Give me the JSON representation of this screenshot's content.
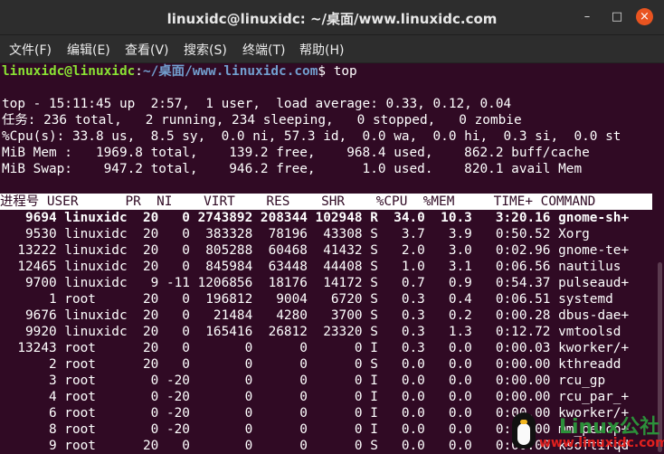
{
  "window": {
    "title": "linuxidc@linuxidc: ~/桌面/www.linuxidc.com",
    "buttons": {
      "minimize": "–",
      "maximize": "□",
      "close": "×"
    },
    "colors": {
      "terminal_bg": "#300a24",
      "prompt_user": "#8ae234",
      "prompt_path": "#729fcf",
      "close_button": "#e95420"
    }
  },
  "menu": [
    {
      "label": "文件(F)"
    },
    {
      "label": "编辑(E)"
    },
    {
      "label": "查看(V)"
    },
    {
      "label": "搜索(S)"
    },
    {
      "label": "终端(T)"
    },
    {
      "label": "帮助(H)"
    }
  ],
  "prompt": {
    "user": "linuxidc@linuxidc",
    "sep": ":",
    "path": "~/桌面/www.linuxidc.com",
    "symbol": "$ ",
    "command": "top"
  },
  "summary": [
    "top - 15:11:45 up  2:57,  1 user,  load average: 0.33, 0.12, 0.04",
    "任务: 236 total,   2 running, 234 sleeping,   0 stopped,   0 zombie",
    "%Cpu(s): 33.8 us,  8.5 sy,  0.0 ni, 57.3 id,  0.0 wa,  0.0 hi,  0.3 si,  0.0 st",
    "MiB Mem :   1969.8 total,    139.2 free,    968.4 used,    862.2 buff/cache",
    "MiB Swap:    947.2 total,    946.2 free,      1.0 used.    820.1 avail Mem"
  ],
  "table": {
    "header": "进程号 USER      PR  NI    VIRT    RES    SHR    %CPU  %MEM     TIME+ COMMAND",
    "rows": [
      "   9694 linuxidc  20   0 2743892 208344 102948 R  34.0  10.3   3:20.16 gnome-sh+",
      "   9530 linuxidc  20   0  383328  78196  43308 S   3.7   3.9   0:50.52 Xorg",
      "  13222 linuxidc  20   0  805288  60468  41432 S   2.0   3.0   0:02.96 gnome-te+",
      "  12465 linuxidc  20   0  845984  63448  44408 S   1.0   3.1   0:06.56 nautilus",
      "   9700 linuxidc   9 -11 1206856  18176  14172 S   0.7   0.9   0:54.37 pulseaud+",
      "      1 root      20   0  196812   9004   6720 S   0.3   0.4   0:06.51 systemd",
      "   9676 linuxidc  20   0   21484   4280   3700 S   0.3   0.2   0:00.28 dbus-dae+",
      "   9920 linuxidc  20   0  165416  26812  23320 S   0.3   1.3   0:12.72 vmtoolsd",
      "  13243 root      20   0       0      0      0 I   0.3   0.0   0:00.03 kworker/+",
      "      2 root      20   0       0      0      0 S   0.0   0.0   0:00.00 kthreadd",
      "      3 root       0 -20       0      0      0 I   0.0   0.0   0:00.00 rcu_gp",
      "      4 root       0 -20       0      0      0 I   0.0   0.0   0:00.00 rcu_par_+",
      "      6 root       0 -20       0      0      0 I   0.0   0.0   0:00.00 kworker/+",
      "      8 root       0 -20       0      0      0 I   0.0   0.0   0:00.00 mm_percp+",
      "      9 root      20   0       0      0      0 S   0.0   0.0   0:00.00 ksoftirqd"
    ]
  },
  "watermark": {
    "brand": "Linux公社",
    "site": "www.linuxidc.com"
  }
}
